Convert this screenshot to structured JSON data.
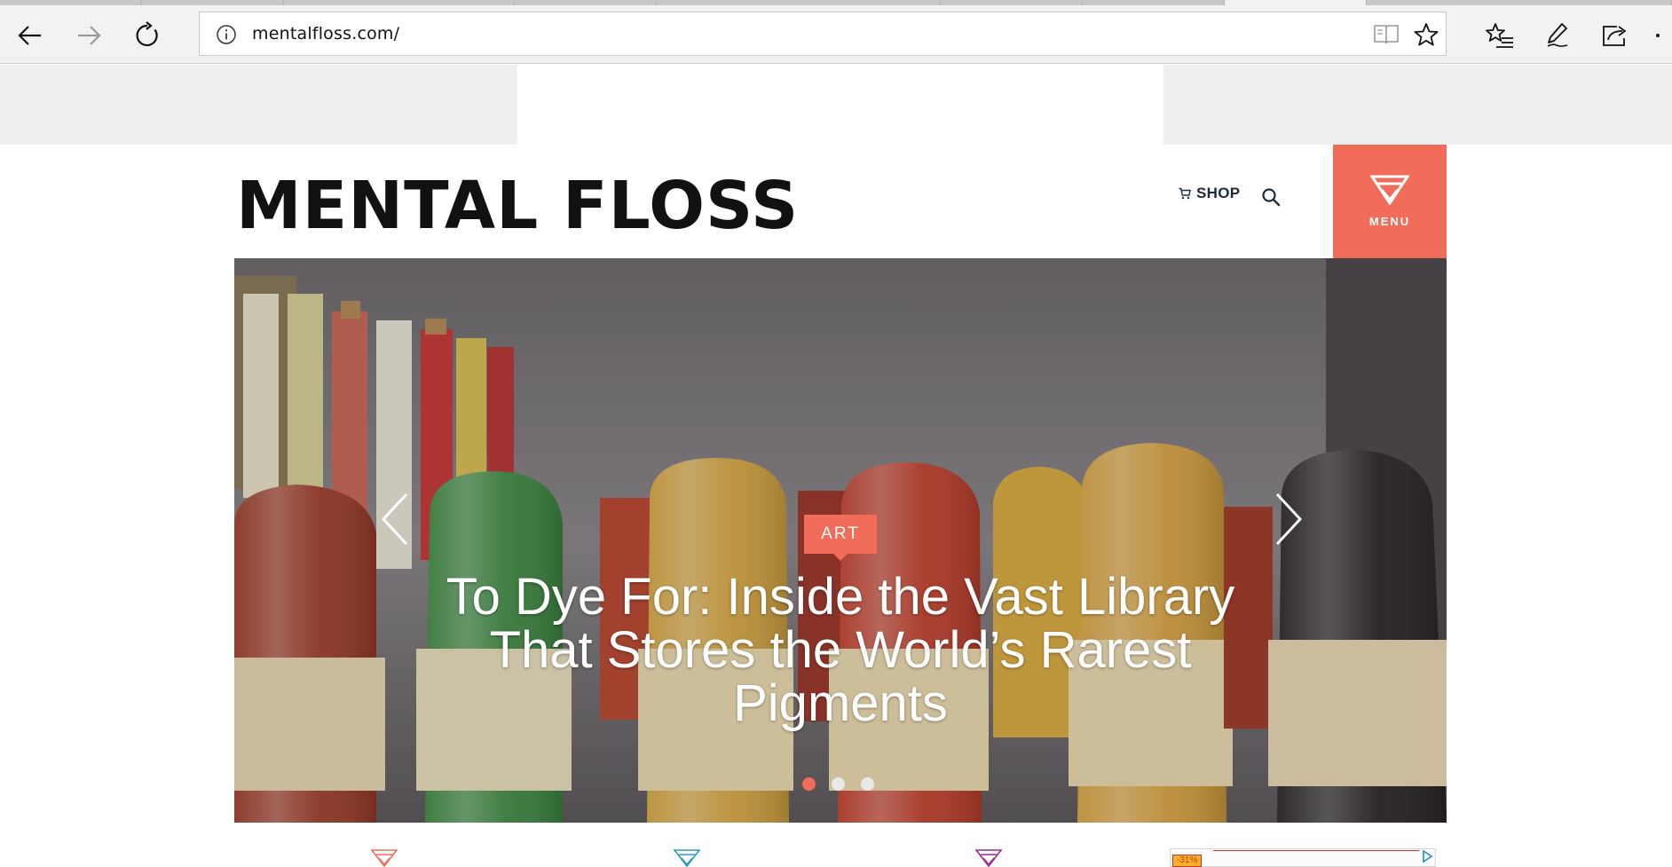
{
  "browser": {
    "url": "mentalfloss.com/",
    "back_label": "Back",
    "forward_label": "Forward",
    "refresh_label": "Refresh",
    "accent": "#f26c5a"
  },
  "site": {
    "logo_text": "MENTAL FLOSS",
    "shop_label": "SHOP",
    "menu_label": "MENU",
    "brand_color": "#f26c5a"
  },
  "hero": {
    "category": "ART",
    "title": "To Dye For: Inside the Vast Library That Stores the World’s Rarest Pigments",
    "slides": 3,
    "active_slide": 1
  },
  "bottom": {
    "category_icons": [
      "coral-chevron-icon",
      "teal-chevron-icon",
      "magenta-chevron-icon"
    ],
    "ad_discount": "-31%"
  }
}
